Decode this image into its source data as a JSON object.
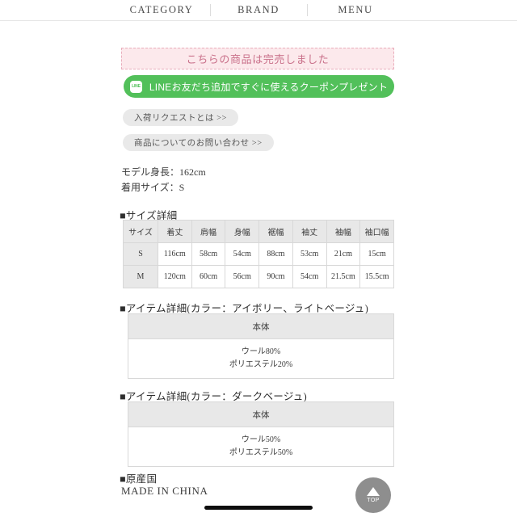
{
  "nav": {
    "items": [
      {
        "label": "CATEGORY",
        "name": "category"
      },
      {
        "label": "BRAND",
        "name": "brand"
      },
      {
        "label": "MENU",
        "name": "menu"
      }
    ]
  },
  "banner": {
    "soldout_text": "こちらの商品は完売しました",
    "background_color": "#fce9ec",
    "text_color": "#c9708a",
    "border_color": "#e9aebc"
  },
  "line_button": {
    "label": "LINEお友だち追加ですぐに使えるクーポンプレゼント",
    "icon_label": "LINE",
    "background_color": "#52c05a"
  },
  "pills": [
    {
      "label": "入荷リクエストとは >>",
      "name": "restock-request"
    },
    {
      "label": "商品についてのお問い合わせ >>",
      "name": "product-inquiry"
    }
  ],
  "model_info": {
    "height": "モデル身長：162cm",
    "wearing_size": "着用サイズ：S"
  },
  "sections": {
    "size_detail_title": "■サイズ詳細",
    "item_detail_title_1": "■アイテム詳細(カラー：アイボリー、ライトベージュ)",
    "item_detail_title_2": "■アイテム詳細(カラー：ダークベージュ)",
    "origin_title": "■原産国"
  },
  "size_table": {
    "headers": [
      "サイズ",
      "着丈",
      "肩幅",
      "身幅",
      "裾幅",
      "袖丈",
      "袖幅",
      "袖口幅"
    ],
    "rows": [
      {
        "size": "S",
        "values": [
          "116cm",
          "58cm",
          "54cm",
          "88cm",
          "53cm",
          "21cm",
          "15cm"
        ]
      },
      {
        "size": "M",
        "values": [
          "120cm",
          "60cm",
          "56cm",
          "90cm",
          "54cm",
          "21.5cm",
          "15.5cm"
        ]
      }
    ]
  },
  "material_tables": [
    {
      "header": "本体",
      "lines": [
        "ウール80%",
        "ポリエステル20%"
      ]
    },
    {
      "header": "本体",
      "lines": [
        "ウール50%",
        "ポリエステル50%"
      ]
    }
  ],
  "origin": {
    "value": "MADE IN CHINA"
  },
  "top_button": {
    "label": "TOP",
    "color": "#8e8e8e"
  }
}
